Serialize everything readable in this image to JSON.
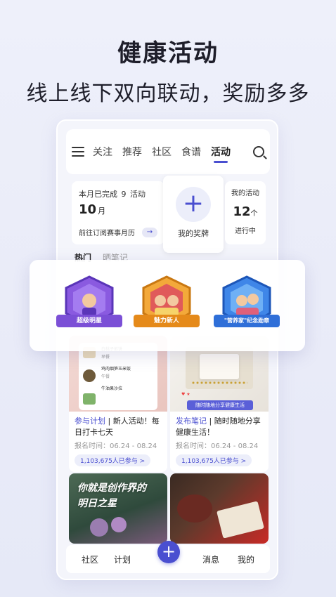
{
  "header": {
    "title": "健康活动",
    "subtitle": "线上线下双向联动，奖励多多"
  },
  "nav": {
    "tabs": [
      "关注",
      "推荐",
      "社区",
      "食谱",
      "活动"
    ],
    "active_tab": "活动"
  },
  "stats": {
    "completed_label": "本月已完成",
    "completed_count": "9",
    "completed_unit": "活动",
    "month_value": "10",
    "month_unit": "月",
    "calendar_link": "前往订阅赛事月历"
  },
  "award": {
    "label": "我的奖牌"
  },
  "my_activities": {
    "title": "我的活动",
    "count": "12",
    "unit": "个",
    "status": "进行中"
  },
  "subtabs": {
    "hot": "热门",
    "notes": "晒笔记"
  },
  "badges": [
    {
      "label": "超级明星",
      "color": "#7b4fd6"
    },
    {
      "label": "魅力新人",
      "color": "#e58a1a"
    },
    {
      "label": "\"营养家\"纪念勋章",
      "color": "#2f6fd8"
    }
  ],
  "posts": [
    {
      "tag": "参与计划",
      "text": "新人活动！每日打卡七天",
      "date": "报名时间：06.24 - 08.24",
      "joined": "1,103,675人已参与 >",
      "inner_items": [
        "白桃子煎饼",
        "早餐",
        "鸡肉烟笋玉米饭",
        "午餐",
        "牛油果沙拉"
      ]
    },
    {
      "tag": "发布笔记",
      "text": "随时随地分享健康生活！",
      "date": "报名时间：06.24 - 08.24",
      "joined": "1,103,675人已参与 >",
      "inner_caption": "随时随地分享健康生活"
    }
  ],
  "photos": [
    {
      "caption_line1": "你就是创作界的",
      "caption_line2": "明日之星"
    }
  ],
  "bottom_nav": {
    "community": "社区",
    "plan": "计划",
    "messages": "消息",
    "mine": "我的"
  },
  "colors": {
    "accent": "#4a4fd0"
  }
}
